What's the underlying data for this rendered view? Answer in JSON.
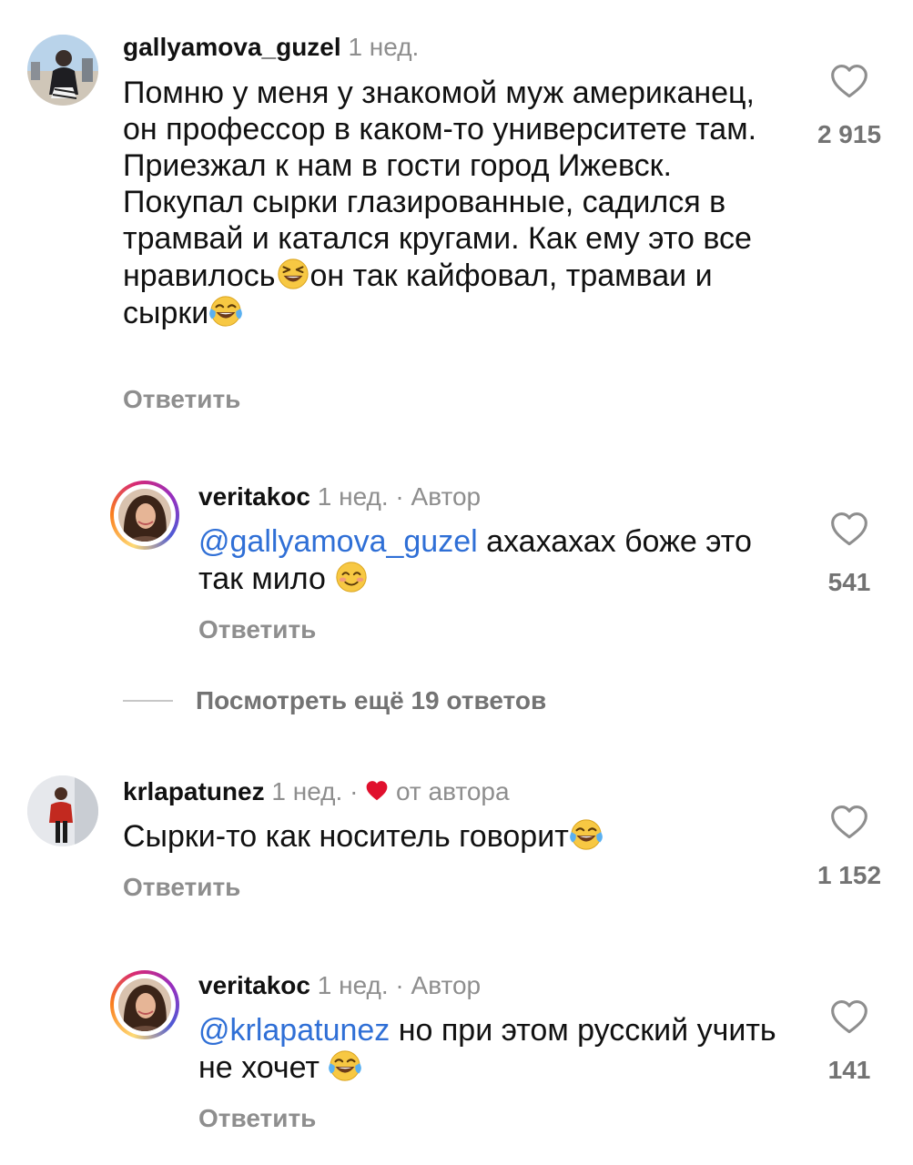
{
  "comments": [
    {
      "username": "gallyamova_guzel",
      "time": "1 нед.",
      "text_parts": [
        "Помню у меня у знакомой муж американец, он профессор в каком-то университете там. Приезжал к нам в гости город Ижевск. Покупал сырки глазированные, садился в трамвай и катался кругами. Как ему это все нравилось",
        "он так кайфовал, трамваи и сырки"
      ],
      "reply_label": "Ответить",
      "likes": "2 915",
      "emojis": [
        "laughing-squint-emoji",
        "tears-of-joy-emoji"
      ]
    },
    {
      "username": "veritakoc",
      "time": "1 нед.",
      "separator": "·",
      "badge": "Автор",
      "mention": "@gallyamova_guzel",
      "text": " ахахахах боже это так мило ",
      "reply_label": "Ответить",
      "likes": "541",
      "emojis": [
        "smiling-blush-emoji"
      ]
    },
    {
      "username": "krlapatunez",
      "time": "1 нед.",
      "separator": "·",
      "badge": "от автора",
      "text": "Сырки-то как носитель говорит",
      "reply_label": "Ответить",
      "likes": "1 152",
      "emojis": [
        "tears-of-joy-emoji"
      ]
    },
    {
      "username": "veritakoc",
      "time": "1 нед.",
      "separator": "·",
      "badge": "Автор",
      "mention": "@krlapatunez",
      "text": " но при этом русский учить не хочет ",
      "reply_label": "Ответить",
      "likes": "141",
      "emojis": [
        "tears-of-joy-emoji"
      ]
    }
  ],
  "view_more_replies": "Посмотреть ещё 19 ответов",
  "colors": {
    "mention": "#2f6fd6",
    "meta": "#8e8e8e",
    "like_count": "#737373",
    "from_author_heart": "#e0102d"
  },
  "icons": {
    "like": "heart-outline-icon",
    "from_author": "red-heart-icon"
  }
}
